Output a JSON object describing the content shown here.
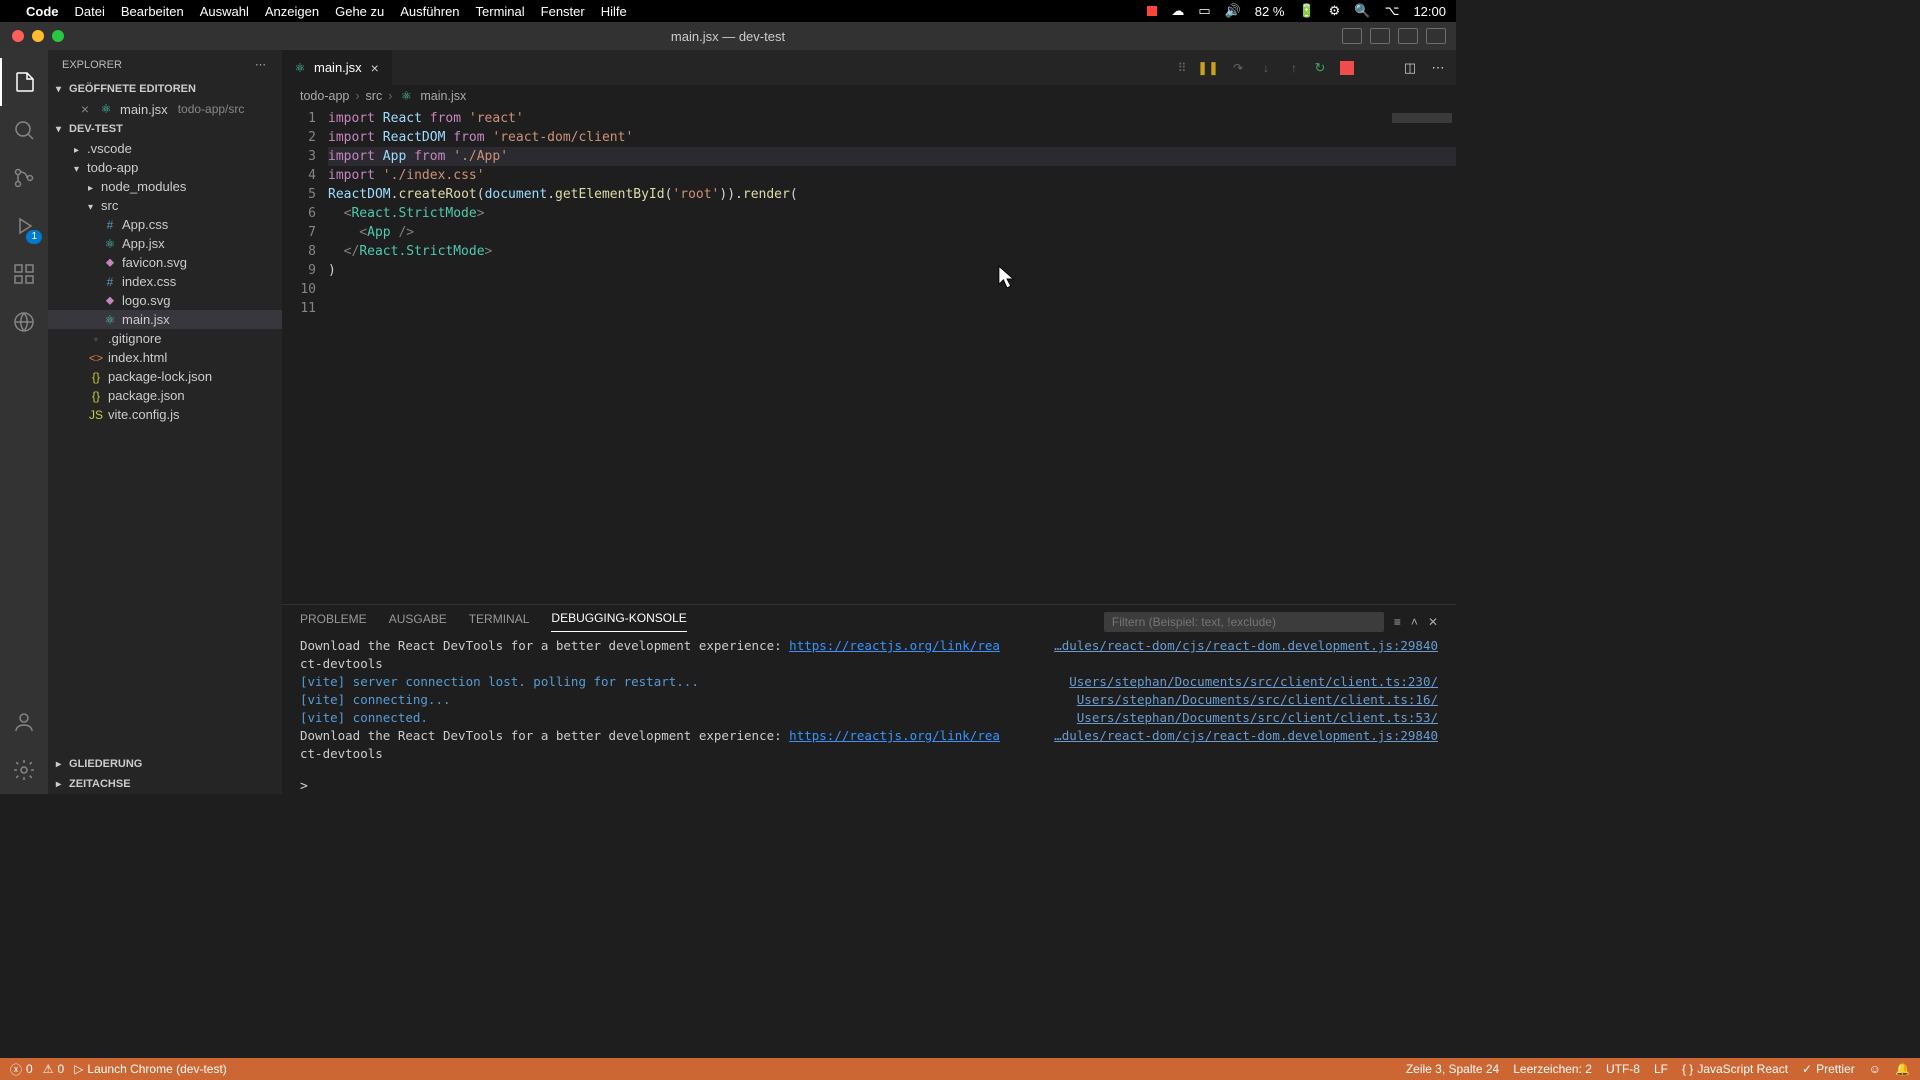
{
  "mac_menu": {
    "app": "Code",
    "items": [
      "Datei",
      "Bearbeiten",
      "Auswahl",
      "Anzeigen",
      "Gehe zu",
      "Ausführen",
      "Terminal",
      "Fenster",
      "Hilfe"
    ],
    "battery": "82 %",
    "time": "12:00"
  },
  "window_title": "main.jsx — dev-test",
  "explorer": {
    "title": "EXPLORER",
    "open_editors_label": "GEÖFFNETE EDITOREN",
    "open_editor": {
      "file": "main.jsx",
      "hint": "todo-app/src"
    },
    "root": "DEV-TEST",
    "items": [
      {
        "type": "folder",
        "name": ".vscode",
        "indent": 1,
        "open": false
      },
      {
        "type": "folder",
        "name": "todo-app",
        "indent": 1,
        "open": true
      },
      {
        "type": "folder",
        "name": "node_modules",
        "indent": 2,
        "open": false
      },
      {
        "type": "folder",
        "name": "src",
        "indent": 2,
        "open": true
      },
      {
        "type": "file",
        "name": "App.css",
        "indent": 3,
        "icon": "css"
      },
      {
        "type": "file",
        "name": "App.jsx",
        "indent": 3,
        "icon": "react"
      },
      {
        "type": "file",
        "name": "favicon.svg",
        "indent": 3,
        "icon": "svg"
      },
      {
        "type": "file",
        "name": "index.css",
        "indent": 3,
        "icon": "css"
      },
      {
        "type": "file",
        "name": "logo.svg",
        "indent": 3,
        "icon": "svg"
      },
      {
        "type": "file",
        "name": "main.jsx",
        "indent": 3,
        "icon": "react",
        "selected": true
      },
      {
        "type": "file",
        "name": ".gitignore",
        "indent": 2,
        "icon": "git"
      },
      {
        "type": "file",
        "name": "index.html",
        "indent": 2,
        "icon": "html"
      },
      {
        "type": "file",
        "name": "package-lock.json",
        "indent": 2,
        "icon": "json"
      },
      {
        "type": "file",
        "name": "package.json",
        "indent": 2,
        "icon": "json"
      },
      {
        "type": "file",
        "name": "vite.config.js",
        "indent": 2,
        "icon": "js"
      }
    ],
    "outline": "GLIEDERUNG",
    "timeline": "ZEITACHSE"
  },
  "activity": {
    "debug_badge": "1"
  },
  "tab": {
    "filename": "main.jsx"
  },
  "breadcrumbs": [
    "todo-app",
    "src",
    "main.jsx"
  ],
  "code": {
    "lines": [
      [
        {
          "t": "import ",
          "c": "kw"
        },
        {
          "t": "React ",
          "c": "id"
        },
        {
          "t": "from ",
          "c": "kw"
        },
        {
          "t": "'react'",
          "c": "st"
        }
      ],
      [
        {
          "t": "import ",
          "c": "kw"
        },
        {
          "t": "ReactDOM ",
          "c": "id"
        },
        {
          "t": "from ",
          "c": "kw"
        },
        {
          "t": "'react-dom/client'",
          "c": "st"
        }
      ],
      [
        {
          "t": "import ",
          "c": "kw"
        },
        {
          "t": "App ",
          "c": "id"
        },
        {
          "t": "from ",
          "c": "kw"
        },
        {
          "t": "'./App'",
          "c": "st"
        }
      ],
      [
        {
          "t": "import ",
          "c": "kw"
        },
        {
          "t": "'./index.css'",
          "c": "st"
        }
      ],
      [
        {
          "t": "",
          "c": ""
        }
      ],
      [
        {
          "t": "ReactDOM",
          "c": "id"
        },
        {
          "t": ".",
          "c": "pn"
        },
        {
          "t": "createRoot",
          "c": "fn"
        },
        {
          "t": "(",
          "c": "pn"
        },
        {
          "t": "document",
          "c": "id"
        },
        {
          "t": ".",
          "c": "pn"
        },
        {
          "t": "getElementById",
          "c": "fn"
        },
        {
          "t": "(",
          "c": "pn"
        },
        {
          "t": "'root'",
          "c": "st"
        },
        {
          "t": ")).",
          "c": "pn"
        },
        {
          "t": "render",
          "c": "fn"
        },
        {
          "t": "(",
          "c": "pn"
        }
      ],
      [
        {
          "t": "  <",
          "c": "br"
        },
        {
          "t": "React.StrictMode",
          "c": "tag"
        },
        {
          "t": ">",
          "c": "br"
        }
      ],
      [
        {
          "t": "    <",
          "c": "br"
        },
        {
          "t": "App ",
          "c": "tag"
        },
        {
          "t": "/>",
          "c": "br"
        }
      ],
      [
        {
          "t": "  </",
          "c": "br"
        },
        {
          "t": "React.StrictMode",
          "c": "tag"
        },
        {
          "t": ">",
          "c": "br"
        }
      ],
      [
        {
          "t": ")",
          "c": "pn"
        }
      ],
      [
        {
          "t": "",
          "c": ""
        }
      ]
    ],
    "highlight_line": 3
  },
  "panel": {
    "tabs": [
      "PROBLEME",
      "AUSGABE",
      "TERMINAL",
      "DEBUGGING-KONSOLE"
    ],
    "active": 3,
    "filter_placeholder": "Filtern (Beispiel: text, !exclude)",
    "lines": [
      {
        "msg": "Download the React DevTools for a better development experience: ",
        "url": "https://reactjs.org/link/rea",
        "cont": "ct-devtools",
        "src": "…dules/react-dom/cjs/react-dom.development.js:29840"
      },
      {
        "color": "blue",
        "msg": "[vite] server connection lost. polling for restart...",
        "src": "Users/stephan/Documents/src/client/client.ts:230/"
      },
      {
        "color": "blue",
        "msg": "[vite] connecting...",
        "src": "Users/stephan/Documents/src/client/client.ts:16/"
      },
      {
        "color": "blue",
        "msg": "[vite] connected.",
        "src": "Users/stephan/Documents/src/client/client.ts:53/"
      },
      {
        "msg": "Download the React DevTools for a better development experience: ",
        "url": "https://reactjs.org/link/rea",
        "cont": "ct-devtools",
        "src": "…dules/react-dom/cjs/react-dom.development.js:29840"
      }
    ],
    "prompt": ">"
  },
  "status": {
    "errors": "0",
    "warnings": "0",
    "launch": "Launch Chrome (dev-test)",
    "cursor": "Zeile 3, Spalte 24",
    "indent": "Leerzeichen: 2",
    "encoding": "UTF-8",
    "eol": "LF",
    "lang": "JavaScript React",
    "prettier": "Prettier"
  }
}
